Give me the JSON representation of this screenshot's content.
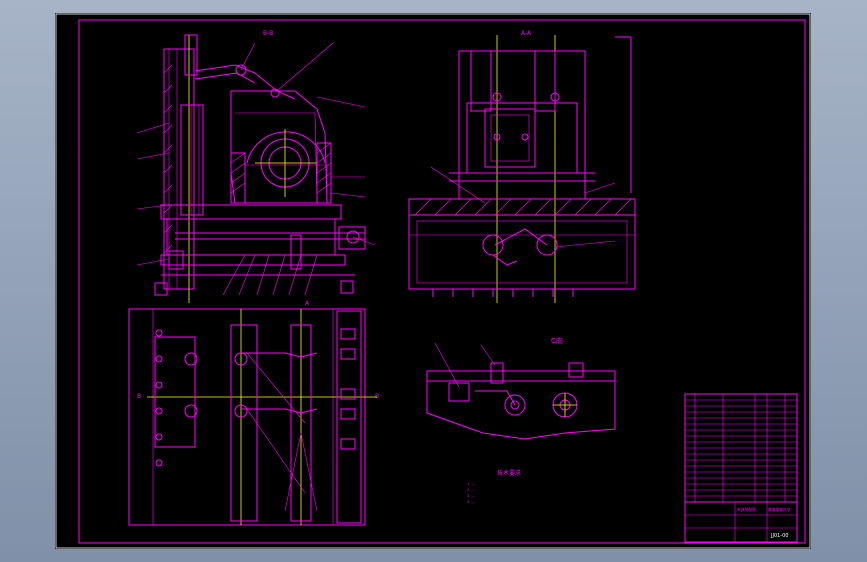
{
  "view_labels": {
    "section_bb": "B-B",
    "section_aa": "A-A",
    "view_c": "C向",
    "arrow_a": "A",
    "arrow_b_left": "B",
    "arrow_b_right": "B"
  },
  "tech_requirements_title": "技术要求",
  "tech_requirements_lines": [
    "1. ...",
    "2. ...",
    "3. ...",
    "4. ..."
  ],
  "title_block": {
    "school": "某某某某大学",
    "drawing_name": "夹具装配图",
    "drawing_no": "JJ01-00"
  },
  "colors": {
    "background": "#000000",
    "lines": "#ff00ff",
    "centerlines": "#ffff00",
    "border": "#ffffff"
  }
}
